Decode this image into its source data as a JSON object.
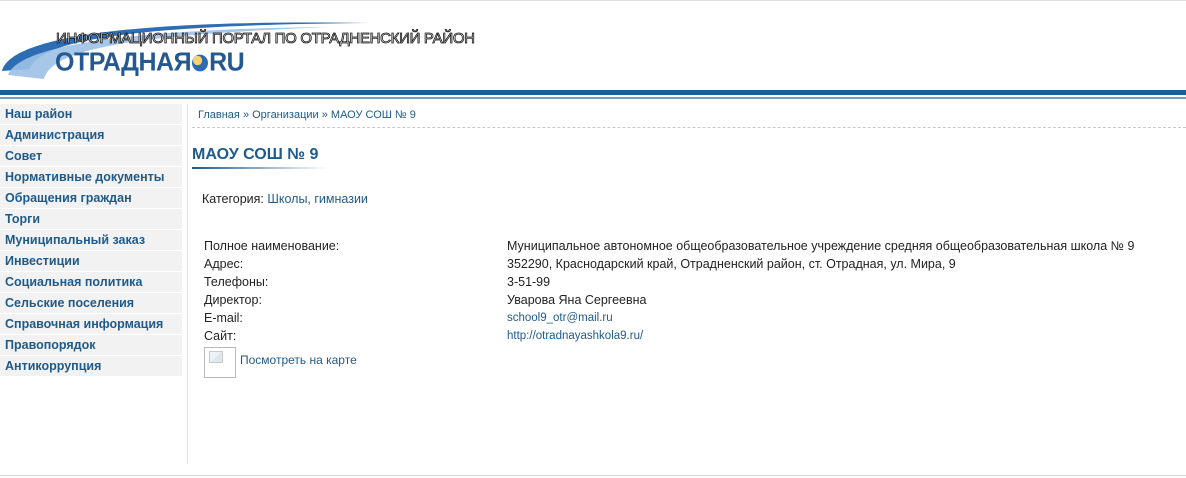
{
  "header": {
    "tagline": "Информационный портал по Отрадненский район",
    "brand_left": "ОТРАДНАЯ",
    "brand_right": "RU"
  },
  "sidebar": {
    "items": [
      {
        "label": "Наш район"
      },
      {
        "label": "Администрация"
      },
      {
        "label": "Совет"
      },
      {
        "label": "Нормативные документы"
      },
      {
        "label": "Обращения граждан"
      },
      {
        "label": "Торги"
      },
      {
        "label": "Муниципальный заказ"
      },
      {
        "label": "Инвестиции"
      },
      {
        "label": "Социальная политика"
      },
      {
        "label": "Сельские поселения"
      },
      {
        "label": "Справочная информация"
      },
      {
        "label": "Правопорядок"
      },
      {
        "label": "Антикоррупция"
      }
    ]
  },
  "breadcrumb": {
    "home": "Главная",
    "sep": "»",
    "section": "Организации",
    "current": "МАОУ СОШ № 9"
  },
  "page": {
    "title": "МАОУ СОШ № 9",
    "category_label": "Категория:",
    "category_value": "Школы, гимназии",
    "map_link": "Посмотреть на карте"
  },
  "info": [
    {
      "label": "Полное наименование:",
      "value": "Муниципальное автономное общеобразовательное учреждение средняя общеобразовательная школа № 9"
    },
    {
      "label": "Адрес:",
      "value": "352290, Краснодарский край, Отрадненский район, ст. Отрадная, ул. Мира, 9"
    },
    {
      "label": "Телефоны:",
      "value": "3-51-99"
    },
    {
      "label": "Директор:",
      "value": "Уварова Яна Сергеевна"
    },
    {
      "label": "E-mail:",
      "value": "school9_otr@mail.ru"
    },
    {
      "label": "Сайт:",
      "value": "http://otradnayashkola9.ru/"
    }
  ],
  "colors": {
    "accent": "#1f5a8b",
    "header_rule": "#1f5e95"
  }
}
